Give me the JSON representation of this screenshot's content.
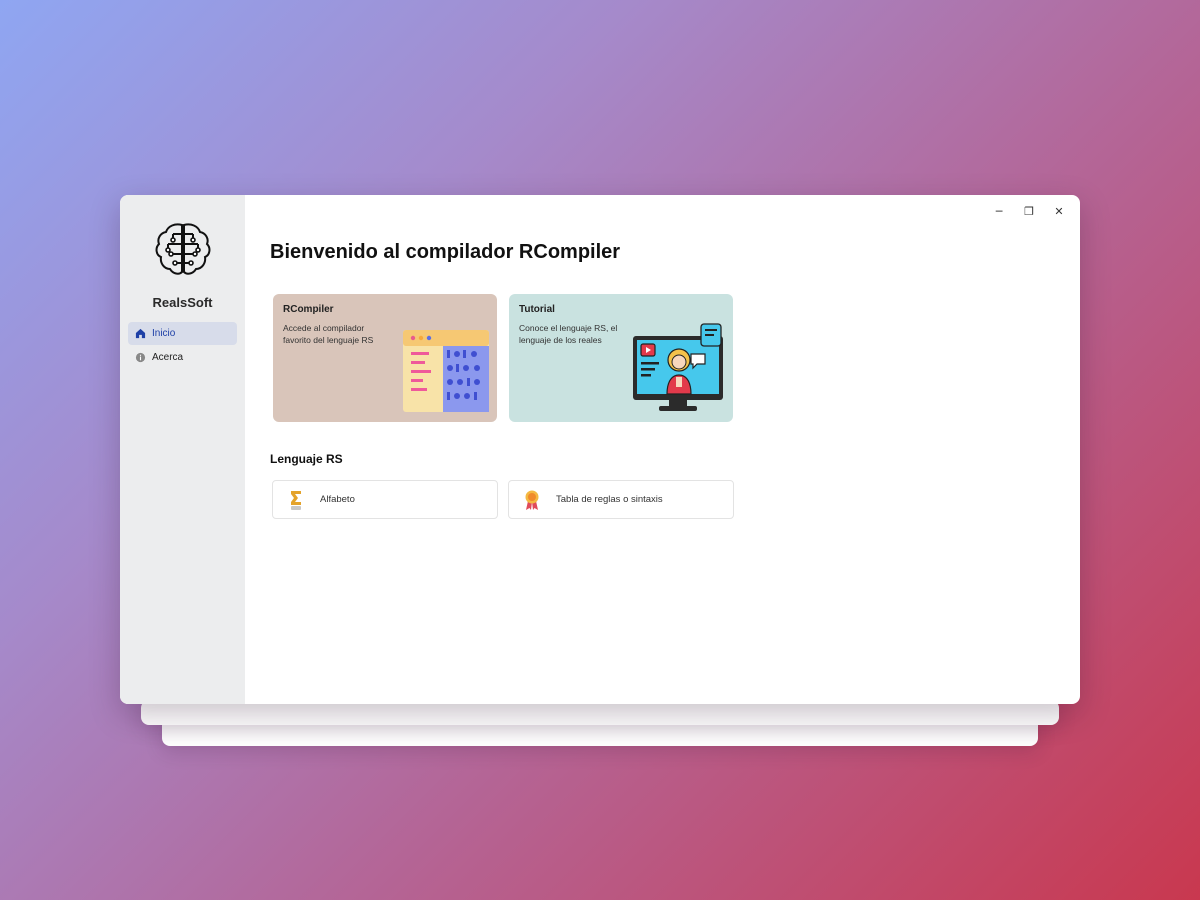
{
  "sidebar": {
    "brand": "RealsSoft",
    "items": [
      {
        "label": "Inicio",
        "icon": "home-icon"
      },
      {
        "label": "Acerca",
        "icon": "info-icon"
      }
    ]
  },
  "window_controls": {
    "minimize": "─",
    "restore": "❐",
    "close": "✕"
  },
  "main": {
    "title": "Bienvenido al compilador RCompiler",
    "cards": [
      {
        "title": "RCompiler",
        "description": "Accede al compilador favorito del lenguaje RS"
      },
      {
        "title": "Tutorial",
        "description": "Conoce el lenguaje RS, el lenguaje de los reales"
      }
    ],
    "section_title": "Lenguaje RS",
    "links": [
      {
        "label": "Alfabeto",
        "icon": "sigma-icon"
      },
      {
        "label": "Tabla de reglas o sintaxis",
        "icon": "award-icon"
      }
    ]
  },
  "colors": {
    "sidebar_bg": "#ecedee",
    "active_nav": "#d7dcea",
    "card1_bg": "#d9c5ba",
    "card2_bg": "#c9e2e0"
  }
}
